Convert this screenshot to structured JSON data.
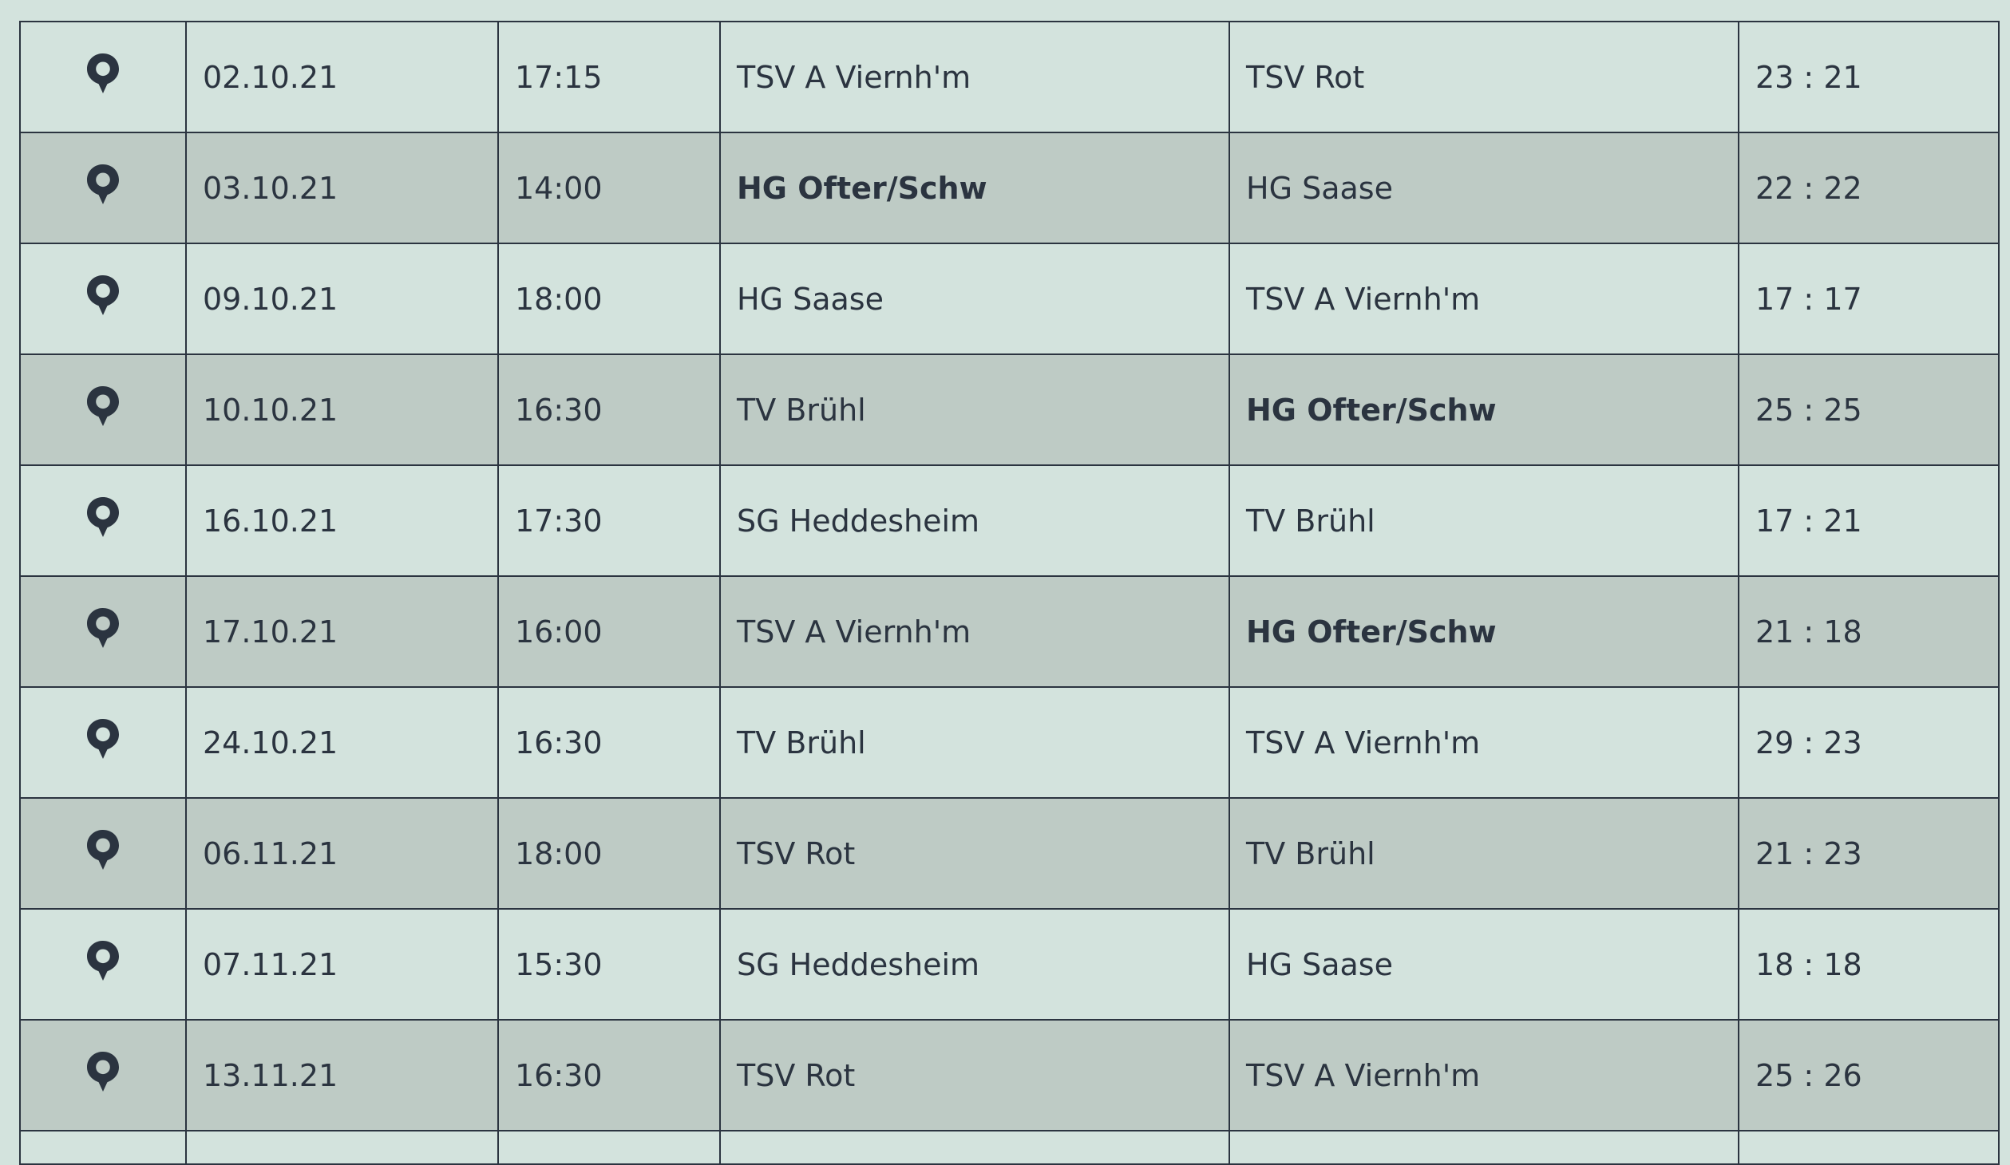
{
  "colors": {
    "background": "#d3e3dd",
    "row_alt": "#becbc5",
    "text": "#2b3440",
    "border": "#2b3440"
  },
  "row_icon": "map-pin-icon",
  "highlight_team": "HG Ofter/Schw",
  "matches": [
    {
      "date": "02.10.21",
      "time": "17:15",
      "home": "TSV A Viernh'm",
      "away": "TSV Rot",
      "score": "23 : 21"
    },
    {
      "date": "03.10.21",
      "time": "14:00",
      "home": "HG Ofter/Schw",
      "away": "HG Saase",
      "score": "22 : 22"
    },
    {
      "date": "09.10.21",
      "time": "18:00",
      "home": "HG Saase",
      "away": "TSV A Viernh'm",
      "score": "17 : 17"
    },
    {
      "date": "10.10.21",
      "time": "16:30",
      "home": "TV Brühl",
      "away": "HG Ofter/Schw",
      "score": "25 : 25"
    },
    {
      "date": "16.10.21",
      "time": "17:30",
      "home": "SG Heddesheim",
      "away": "TV Brühl",
      "score": "17 : 21"
    },
    {
      "date": "17.10.21",
      "time": "16:00",
      "home": "TSV A Viernh'm",
      "away": "HG Ofter/Schw",
      "score": "21 : 18"
    },
    {
      "date": "24.10.21",
      "time": "16:30",
      "home": "TV Brühl",
      "away": "TSV A Viernh'm",
      "score": "29 : 23"
    },
    {
      "date": "06.11.21",
      "time": "18:00",
      "home": "TSV Rot",
      "away": "TV Brühl",
      "score": "21 : 23"
    },
    {
      "date": "07.11.21",
      "time": "15:30",
      "home": "SG Heddesheim",
      "away": "HG Saase",
      "score": "18 : 18"
    },
    {
      "date": "13.11.21",
      "time": "16:30",
      "home": "TSV Rot",
      "away": "TSV A Viernh'm",
      "score": "25 : 26"
    }
  ]
}
